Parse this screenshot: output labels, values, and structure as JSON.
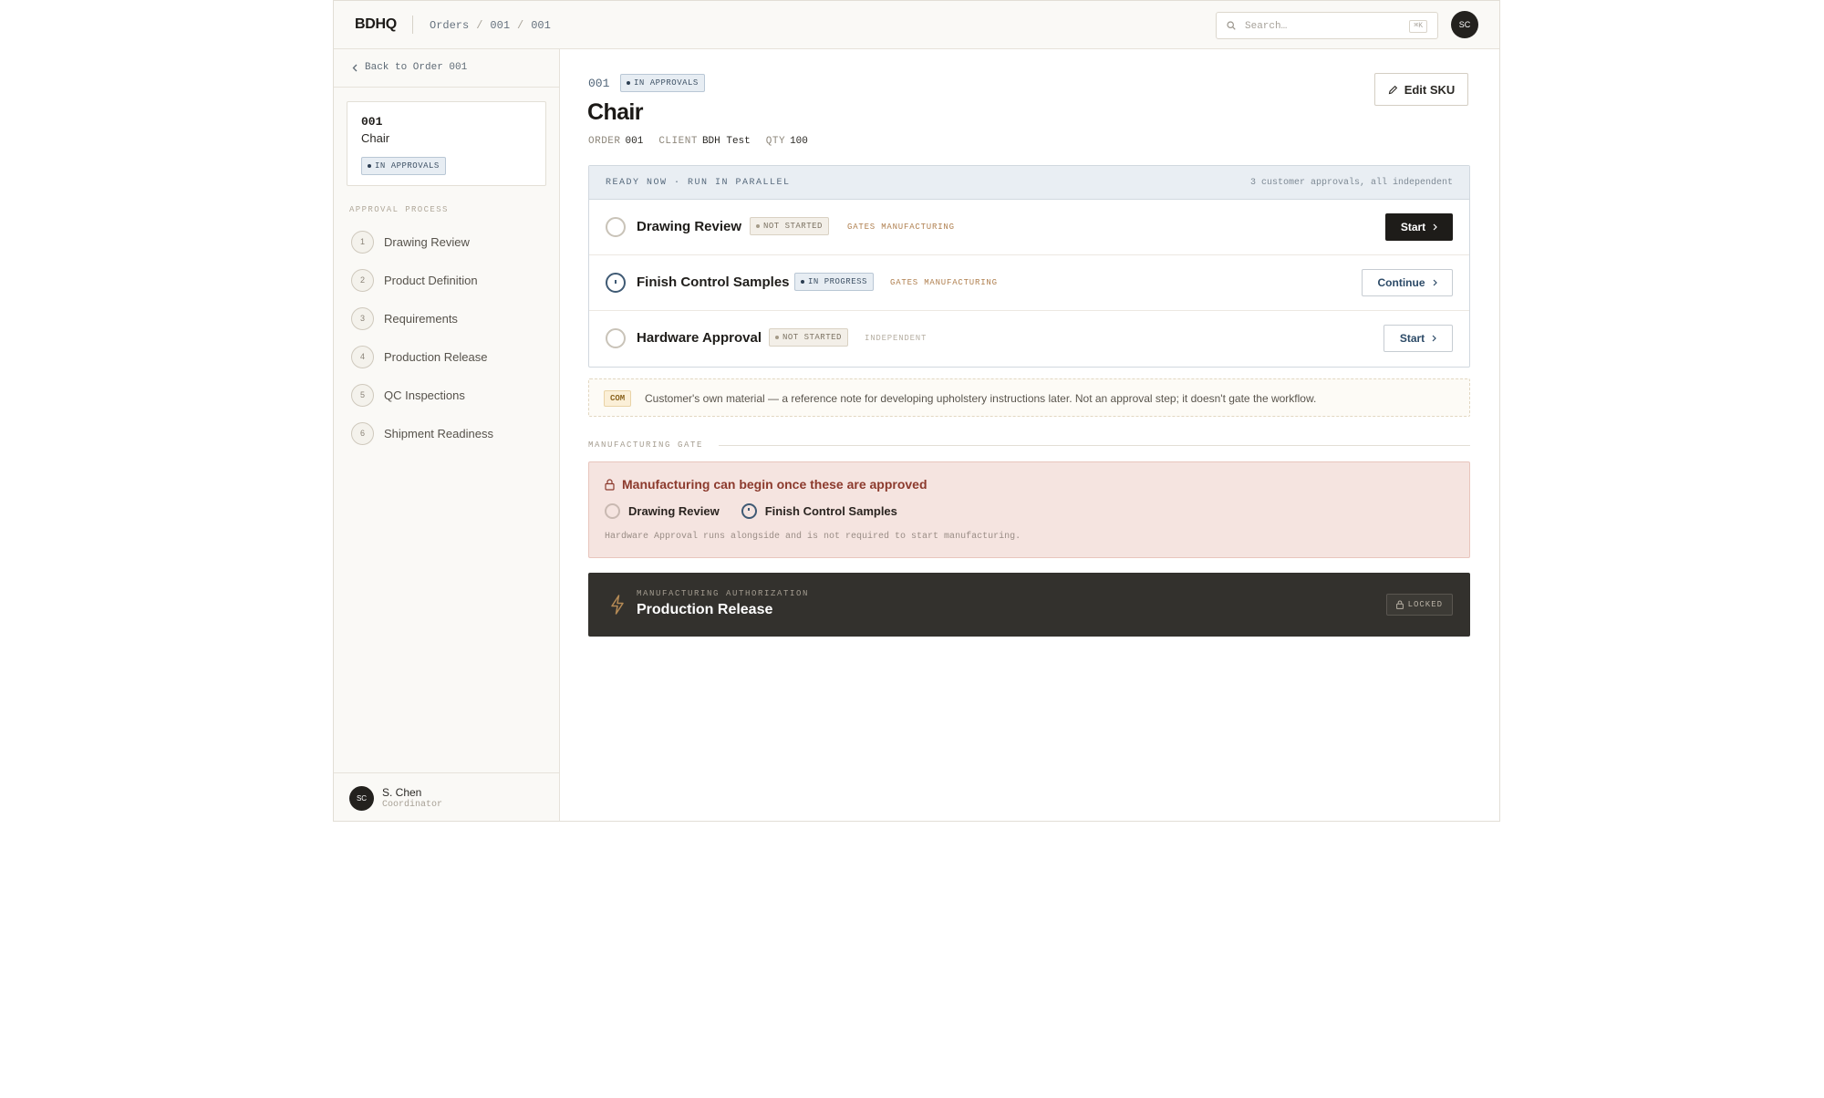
{
  "topbar": {
    "brand": "BDHQ",
    "breadcrumbs": [
      "Orders",
      "/",
      "001",
      "/",
      "001"
    ],
    "search_placeholder": "Search…",
    "search_shortcut": "⌘K",
    "avatar_initials": "SC"
  },
  "sidebar": {
    "back_label": "Back to Order 001",
    "sku_card": {
      "number": "001",
      "name": "Chair",
      "status": "IN APPROVALS"
    },
    "process_title": "APPROVAL PROCESS",
    "steps": [
      {
        "num": "1",
        "label": "Drawing Review"
      },
      {
        "num": "2",
        "label": "Product Definition"
      },
      {
        "num": "3",
        "label": "Requirements"
      },
      {
        "num": "4",
        "label": "Production Release"
      },
      {
        "num": "5",
        "label": "QC Inspections"
      },
      {
        "num": "6",
        "label": "Shipment Readiness"
      }
    ],
    "user": {
      "initials": "SC",
      "name": "S. Chen",
      "role": "Coordinator"
    }
  },
  "header": {
    "number": "001",
    "status": "IN APPROVALS",
    "title": "Chair",
    "meta": {
      "order_key": "ORDER",
      "order_val": "001",
      "client_key": "CLIENT",
      "client_val": "BDH Test",
      "qty_key": "QTY",
      "qty_val": "100"
    },
    "edit_label": "Edit SKU"
  },
  "parallel": {
    "heading": "READY NOW · RUN IN PARALLEL",
    "note": "3 customer approvals, all independent",
    "rows": [
      {
        "name": "Drawing Review",
        "status": "NOT STARTED",
        "tag": "GATES MANUFACTURING",
        "action": "Start"
      },
      {
        "name": "Finish Control Samples",
        "status": "IN PROGRESS",
        "tag": "GATES MANUFACTURING",
        "action": "Continue"
      },
      {
        "name": "Hardware Approval",
        "status": "NOT STARTED",
        "tag": "INDEPENDENT",
        "action": "Start"
      }
    ]
  },
  "com": {
    "tag": "COM",
    "text": "Customer's own material — a reference note for developing upholstery instructions later. Not an approval step; it doesn't gate the workflow."
  },
  "gate": {
    "label": "MANUFACTURING GATE",
    "heading": "Manufacturing can begin once these are approved",
    "items": [
      "Drawing Review",
      "Finish Control Samples"
    ],
    "note": "Hardware Approval runs alongside and is not required to start manufacturing."
  },
  "release": {
    "sub": "MANUFACTURING AUTHORIZATION",
    "title": "Production Release",
    "lock_label": "LOCKED"
  },
  "colors": {
    "accent_dark": "#1e1c19",
    "approval_blue": "#3f5266",
    "gate_red": "#8c3a2d",
    "gate_bg": "#f5e4e0",
    "release_bg": "#33312d"
  }
}
